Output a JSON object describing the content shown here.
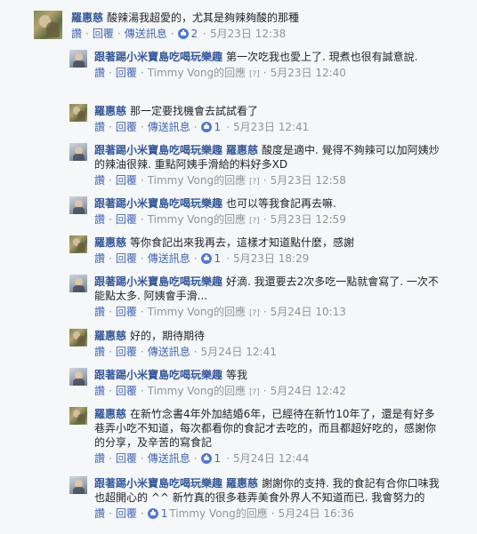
{
  "labels": {
    "like": "讚",
    "reply": "回覆",
    "send": "傳送訊息"
  },
  "comments": [
    {
      "name": "羅惠慈",
      "text": "酸辣湯我超愛的，尤其是夠辣夠酸的那種",
      "likes": "2",
      "time": "5月23日 12:38"
    },
    {
      "name": "跟著踢小米寶島吃喝玩樂趣",
      "text": "第一次吃我也愛上了. 現煮也很有誠意說.",
      "reply_meta": "Timmy Vong的回應",
      "edited": "[?]",
      "time": "5月23日 12:40"
    },
    {
      "name": "羅惠慈",
      "text": "那一定要找機會去試試看了",
      "likes": "1",
      "time": "5月23日 12:41"
    },
    {
      "name": "跟著踢小米寶島吃喝玩樂趣",
      "tag": "羅惠慈",
      "text": "酸度是適中. 覺得不夠辣可以加阿姨炒的辣油很辣. 重點阿姨手滑給的料好多XD",
      "reply_meta": "Timmy Vong的回應",
      "edited": "[?]",
      "time": "5月23日 12:58"
    },
    {
      "name": "跟著踢小米寶島吃喝玩樂趣",
      "text": "也可以等我食記再去嘛.",
      "reply_meta": "Timmy Vong的回應",
      "edited": "[?]",
      "time": "5月23日 12:59"
    },
    {
      "name": "羅惠慈",
      "text": "等你食記出來我再去，這樣才知道點什麼，感謝",
      "likes": "1",
      "time": "5月23日 18:29"
    },
    {
      "name": "跟著踢小米寶島吃喝玩樂趣",
      "text": "好滴. 我還要去2次多吃一點就會寫了. 一次不能點太多. 阿姨會手滑...",
      "reply_meta": "Timmy Vong的回應",
      "edited": "[?]",
      "time": "5月24日 10:13"
    },
    {
      "name": "羅惠慈",
      "text": "好的，期待期待",
      "time": "5月24日 12:41"
    },
    {
      "name": "跟著踢小米寶島吃喝玩樂趣",
      "text": "等我",
      "reply_meta": "Timmy Vong的回應",
      "edited": "[?]",
      "time": "5月24日 12:42"
    },
    {
      "name": "羅惠慈",
      "text": "在新竹念書4年外加結婚6年，已經待在新竹10年了，還是有好多巷弄小吃不知道，每次都看你的食記才去吃的，而且都超好吃的，感謝你的分享，及辛苦的寫食記",
      "likes": "1",
      "time": "5月24日 12:44"
    },
    {
      "name": "跟著踢小米寶島吃喝玩樂趣",
      "tag": "羅惠慈",
      "text": "謝謝你的支持. 我的食記有合你口味我也超開心的 ^^ 新竹真的很多巷弄美食外界人不知道而已. 我會努力的",
      "likes": "1",
      "reply_meta": "Timmy Vong的回應",
      "time": "5月24日 16:36"
    }
  ]
}
